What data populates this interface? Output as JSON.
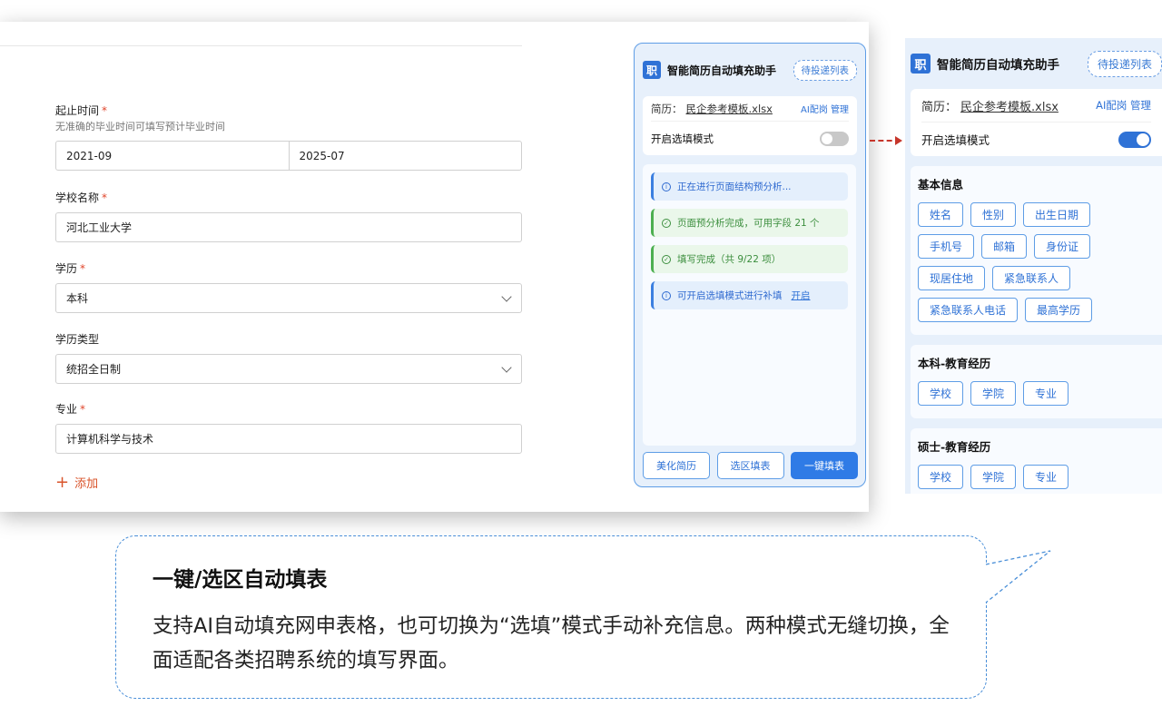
{
  "form": {
    "date_field": {
      "label": "起止时间",
      "required": "*",
      "hint": "无准确的毕业时间可填写预计毕业时间",
      "start": "2021-09",
      "end": "2025-07"
    },
    "school_field": {
      "label": "学校名称",
      "required": "*",
      "value": "河北工业大学"
    },
    "degree_field": {
      "label": "学历",
      "required": "*",
      "value": "本科"
    },
    "degree_type_field": {
      "label": "学历类型",
      "value": "统招全日制"
    },
    "major_field": {
      "label": "专业",
      "required": "*",
      "value": "计算机科学与技术"
    },
    "add_label": "添加"
  },
  "panel": {
    "logo_text": "职",
    "title": "智能简历自动填充助手",
    "pending_btn": "待投递列表",
    "resume_label": "简历：",
    "resume_file": "民企参考模板.xlsx",
    "resume_actions": "AI配岗 管理",
    "mode_label": "开启选填模式",
    "mode_on": false,
    "logs": [
      {
        "type": "info",
        "text": "正在进行页面结构预分析..."
      },
      {
        "type": "ok",
        "text": "页面预分析完成，可用字段 21 个"
      },
      {
        "type": "ok",
        "text": "填写完成（共 9/22 项）"
      },
      {
        "type": "info",
        "text": "可开启选填模式进行补填",
        "link": "开启"
      }
    ],
    "buttons": {
      "beautify": "美化简历",
      "select_fill": "选区填表",
      "one_click": "一键填表"
    }
  },
  "panel_expanded": {
    "logo_text": "职",
    "title": "智能简历自动填充助手",
    "pending_btn": "待投递列表",
    "resume_label": "简历：",
    "resume_file": "民企参考模板.xlsx",
    "resume_actions": "AI配岗 管理",
    "mode_label": "开启选填模式",
    "mode_on": true,
    "groups": [
      {
        "title": "基本信息",
        "chips": [
          "姓名",
          "性别",
          "出生日期",
          "手机号",
          "邮箱",
          "身份证",
          "现居住地",
          "紧急联系人",
          "紧急联系人电话",
          "最高学历"
        ]
      },
      {
        "title": "本科-教育经历",
        "chips": [
          "学校",
          "学院",
          "专业"
        ]
      },
      {
        "title": "硕士-教育经历",
        "chips": [
          "学校",
          "学院",
          "专业"
        ]
      }
    ]
  },
  "callout": {
    "title": "一键/选区自动填表",
    "body": "支持AI自动填充网申表格，也可切换为“选填”模式手动补充信息。两种模式无缝切换，全面适配各类招聘系统的填写界面。"
  },
  "colors": {
    "accent": "#2f72d6",
    "required": "#e0452b",
    "add_link": "#d9542b",
    "arrow": "#c6362b"
  }
}
